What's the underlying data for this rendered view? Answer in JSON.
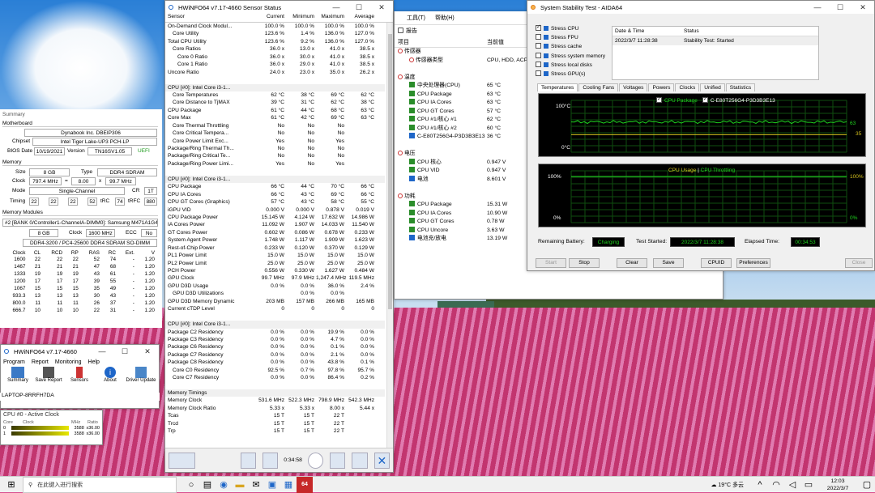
{
  "hwinfo_sensor": {
    "title": "HWiNFO64 v7.17-4660 Sensor Status",
    "headers": [
      "Sensor",
      "Current",
      "Minimum",
      "Maximum",
      "Average"
    ],
    "rows": [
      {
        "k": "i",
        "c": [
          "On-Demand Clock Modul...",
          "100.0 %",
          "100.0 %",
          "100.0 %",
          "100.0 %"
        ]
      },
      {
        "k": "c",
        "c": [
          "Core Utility",
          "123.6 %",
          "1.4 %",
          "136.0 %",
          "127.0 %"
        ]
      },
      {
        "k": "i",
        "c": [
          "Total CPU Utility",
          "123.6 %",
          "9.2 %",
          "136.0 %",
          "127.0 %"
        ]
      },
      {
        "k": "c",
        "c": [
          "Core Ratios",
          "36.0 x",
          "13.0 x",
          "41.0 x",
          "38.5 x"
        ]
      },
      {
        "k": "d",
        "c": [
          "Core 0 Ratio",
          "36.0 x",
          "30.0 x",
          "41.0 x",
          "38.5 x"
        ]
      },
      {
        "k": "d",
        "c": [
          "Core 1 Ratio",
          "36.0 x",
          "29.0 x",
          "41.0 x",
          "38.5 x"
        ]
      },
      {
        "k": "i",
        "c": [
          "Uncore Ratio",
          "24.0 x",
          "23.0 x",
          "35.0 x",
          "26.2 x"
        ]
      },
      {
        "k": "b",
        "c": [
          "",
          "",
          "",
          "",
          ""
        ]
      },
      {
        "k": "s",
        "c": [
          "CPU [#0]: Intel Core i3-1...",
          "",
          "",
          "",
          ""
        ]
      },
      {
        "k": "c",
        "c": [
          "Core Temperatures",
          "62 °C",
          "38 °C",
          "69 °C",
          "62 °C"
        ]
      },
      {
        "k": "c",
        "c": [
          "Core Distance to TjMAX",
          "39 °C",
          "31 °C",
          "62 °C",
          "38 °C"
        ]
      },
      {
        "k": "t",
        "c": [
          "CPU Package",
          "61 °C",
          "44 °C",
          "68 °C",
          "63 °C"
        ]
      },
      {
        "k": "t",
        "c": [
          "Core Max",
          "61 °C",
          "42 °C",
          "69 °C",
          "63 °C"
        ]
      },
      {
        "k": "c",
        "c": [
          "Core Thermal Throttling",
          "No",
          "No",
          "No",
          ""
        ]
      },
      {
        "k": "c",
        "c": [
          "Core Critical Tempera...",
          "No",
          "No",
          "No",
          ""
        ]
      },
      {
        "k": "c",
        "c": [
          "Core Power Limit Exc...",
          "Yes",
          "No",
          "Yes",
          ""
        ]
      },
      {
        "k": "i",
        "c": [
          "Package/Ring Thermal Th...",
          "No",
          "No",
          "No",
          ""
        ]
      },
      {
        "k": "i",
        "c": [
          "Package/Ring Critical Te...",
          "No",
          "No",
          "No",
          ""
        ]
      },
      {
        "k": "i",
        "c": [
          "Package/Ring Power Limi...",
          "Yes",
          "No",
          "Yes",
          ""
        ]
      },
      {
        "k": "b",
        "c": [
          "",
          "",
          "",
          "",
          ""
        ]
      },
      {
        "k": "s",
        "c": [
          "CPU [#0]: Intel Core i3-1...",
          "",
          "",
          "",
          ""
        ]
      },
      {
        "k": "t",
        "c": [
          "CPU Package",
          "66 °C",
          "44 °C",
          "70 °C",
          "66 °C"
        ]
      },
      {
        "k": "t",
        "c": [
          "CPU IA Cores",
          "66 °C",
          "43 °C",
          "69 °C",
          "66 °C"
        ]
      },
      {
        "k": "t",
        "c": [
          "CPU GT Cores (Graphics)",
          "57 °C",
          "43 °C",
          "58 °C",
          "55 °C"
        ]
      },
      {
        "k": "i",
        "c": [
          "iGPU VID",
          "0.000 V",
          "0.000 V",
          "0.878 V",
          "0.019 V"
        ]
      },
      {
        "k": "i",
        "c": [
          "CPU Package Power",
          "15.145 W",
          "4.124 W",
          "17.632 W",
          "14.986 W"
        ]
      },
      {
        "k": "i",
        "c": [
          "IA Cores Power",
          "11.092 W",
          "1.907 W",
          "14.033 W",
          "11.540 W"
        ]
      },
      {
        "k": "i",
        "c": [
          "GT Cores Power",
          "0.602 W",
          "0.086 W",
          "0.678 W",
          "0.233 W"
        ]
      },
      {
        "k": "i",
        "c": [
          "System Agent Power",
          "1.748 W",
          "1.117 W",
          "1.909 W",
          "1.623 W"
        ]
      },
      {
        "k": "i",
        "c": [
          "Rest-of-Chip Power",
          "0.233 W",
          "0.120 W",
          "0.370 W",
          "0.129 W"
        ]
      },
      {
        "k": "i",
        "c": [
          "PL1 Power Limit",
          "15.0 W",
          "15.0 W",
          "15.0 W",
          "15.0 W"
        ]
      },
      {
        "k": "i",
        "c": [
          "PL2 Power Limit",
          "25.0 W",
          "25.0 W",
          "25.0 W",
          "25.0 W"
        ]
      },
      {
        "k": "i",
        "c": [
          "PCH Power",
          "0.556 W",
          "0.330 W",
          "1.627 W",
          "0.484 W"
        ]
      },
      {
        "k": "i",
        "c": [
          "GPU Clock",
          "99.7 MHz",
          "97.9 MHz",
          "1,247.4 MHz",
          "119.5 MHz"
        ]
      },
      {
        "k": "i",
        "c": [
          "GPU D3D Usage",
          "0.0 %",
          "0.0 %",
          "36.0 %",
          "2.4 %"
        ]
      },
      {
        "k": "c",
        "c": [
          "GPU D3D Utilizations",
          "",
          "0.0 %",
          "0.0 %",
          ""
        ]
      },
      {
        "k": "i",
        "c": [
          "GPU D3D Memory Dynamic",
          "203 MB",
          "157 MB",
          "266 MB",
          "165 MB"
        ]
      },
      {
        "k": "i",
        "c": [
          "Current cTDP Level",
          "0",
          "0",
          "0",
          "0"
        ]
      },
      {
        "k": "b",
        "c": [
          "",
          "",
          "",
          "",
          ""
        ]
      },
      {
        "k": "s",
        "c": [
          "CPU [#0]: Intel Core i3-1...",
          "",
          "",
          "",
          ""
        ]
      },
      {
        "k": "i",
        "c": [
          "Package C2 Residency",
          "0.0 %",
          "0.0 %",
          "19.9 %",
          "0.0 %"
        ]
      },
      {
        "k": "i",
        "c": [
          "Package C3 Residency",
          "0.0 %",
          "0.0 %",
          "4.7 %",
          "0.0 %"
        ]
      },
      {
        "k": "i",
        "c": [
          "Package C6 Residency",
          "0.0 %",
          "0.0 %",
          "0.1 %",
          "0.0 %"
        ]
      },
      {
        "k": "i",
        "c": [
          "Package C7 Residency",
          "0.0 %",
          "0.0 %",
          "2.1 %",
          "0.0 %"
        ]
      },
      {
        "k": "i",
        "c": [
          "Package C8 Residency",
          "0.0 %",
          "0.0 %",
          "43.8 %",
          "0.1 %"
        ]
      },
      {
        "k": "c",
        "c": [
          "Core C0 Residency",
          "92.5 %",
          "0.7 %",
          "97.8 %",
          "95.7 %"
        ]
      },
      {
        "k": "c",
        "c": [
          "Core C7 Residency",
          "0.0 %",
          "0.0 %",
          "86.4 %",
          "0.2 %"
        ]
      },
      {
        "k": "b",
        "c": [
          "",
          "",
          "",
          "",
          ""
        ]
      },
      {
        "k": "s",
        "c": [
          "Memory Timings",
          "",
          "",
          "",
          ""
        ]
      },
      {
        "k": "i",
        "c": [
          "Memory Clock",
          "531.6 MHz",
          "522.3 MHz",
          "798.9 MHz",
          "542.3 MHz"
        ]
      },
      {
        "k": "i",
        "c": [
          "Memory Clock Ratio",
          "5.33 x",
          "5.33 x",
          "8.00 x",
          "5.44 x"
        ]
      },
      {
        "k": "i",
        "c": [
          "Tcas",
          "15 T",
          "15 T",
          "22 T",
          ""
        ]
      },
      {
        "k": "i",
        "c": [
          "Trcd",
          "15 T",
          "15 T",
          "22 T",
          ""
        ]
      },
      {
        "k": "i",
        "c": [
          "Trp",
          "15 T",
          "15 T",
          "22 T",
          ""
        ]
      }
    ],
    "timer": "0:34:58"
  },
  "hwinfo_summary": {
    "summary_label": "Summary",
    "motherboard_label": "Motherboard",
    "motherboard": "Dynabook Inc. DBEIP306",
    "chipset_label": "Chipset",
    "chipset": "Intel Tiger Lake-UP3 PCH-LP",
    "bios_label": "BIOS Date",
    "bios_date": "10/19/2021",
    "version_label": "Version",
    "version": "TN16SV1.05",
    "uefi": "UEFI",
    "memory_label": "Memory",
    "size_label": "Size",
    "size": "8 GB",
    "type_label": "Type",
    "type": "DDR4 SDRAM",
    "clock_label": "Clock",
    "clock": "797.4 MHz",
    "eq": "=",
    "mult": "8.00",
    "x": "x",
    "base": "99.7 MHz",
    "mode_label": "Mode",
    "mode": "Single-Channel",
    "cr_label": "CR",
    "cr": "1T",
    "timing_label": "Timing",
    "timings": [
      "22",
      "22",
      "22",
      "52"
    ],
    "trc_label": "tRC",
    "trc": "74",
    "trfc_label": "tRFC",
    "trfc": "880",
    "modules_label": "Memory Modules",
    "module": "#2 [BANK 0/Controller1-ChannelA-DIMM0]: Samsung M471A1G44",
    "m_size": "8 GB",
    "m_clock_label": "Clock",
    "m_clock": "1600 MHz",
    "ecc_label": "ECC",
    "ecc": "No",
    "m_type": "DDR4-3200 / PC4-25600 DDR4 SDRAM SO-DIMM",
    "table_headers": [
      "Clock",
      "CL",
      "RCD",
      "RP",
      "RAS",
      "RC",
      "Ext.",
      "V"
    ],
    "table_rows": [
      [
        "1600",
        "22",
        "22",
        "22",
        "52",
        "74",
        "-",
        "1.20"
      ],
      [
        "1467",
        "21",
        "21",
        "21",
        "47",
        "68",
        "-",
        "1.20"
      ],
      [
        "1333",
        "19",
        "19",
        "19",
        "43",
        "61",
        "-",
        "1.20"
      ],
      [
        "1200",
        "17",
        "17",
        "17",
        "39",
        "55",
        "-",
        "1.20"
      ],
      [
        "1067",
        "15",
        "15",
        "15",
        "35",
        "49",
        "-",
        "1.20"
      ],
      [
        "933.3",
        "13",
        "13",
        "13",
        "30",
        "43",
        "-",
        "1.20"
      ],
      [
        "800.0",
        "11",
        "11",
        "11",
        "26",
        "37",
        "-",
        "1.20"
      ],
      [
        "666.7",
        "10",
        "10",
        "10",
        "22",
        "31",
        "-",
        "1.20"
      ]
    ]
  },
  "hwinfo_main": {
    "title": "HWiNFO64 v7.17-4660",
    "menu": [
      "Program",
      "Report",
      "Monitoring",
      "Help"
    ],
    "tools": [
      "Summary",
      "Save Report",
      "Sensors",
      "About",
      "Driver Update"
    ],
    "host": "LAPTOP-8RRFH7DA"
  },
  "active_clock": {
    "title": "CPU #0 - Active Clock",
    "headers": [
      "Core",
      "Clock",
      "MHz",
      "Ratio"
    ],
    "rows": [
      [
        "0",
        "3588",
        "x36.00"
      ],
      [
        "1",
        "3588",
        "x36.00"
      ]
    ]
  },
  "aida_menu": {
    "tools": "工具(T)",
    "help": "帮助(H)",
    "report": "报告"
  },
  "aida_tree": {
    "headers": [
      "项目",
      "当前值"
    ],
    "items": [
      {
        "icon": "sensor",
        "label": "传感器",
        "value": "",
        "lvl": 0
      },
      {
        "icon": "sensor",
        "label": "传感器类型",
        "value": "CPU, HDD, ACP",
        "lvl": 1
      },
      {
        "icon": "",
        "label": "",
        "value": "",
        "lvl": 0
      },
      {
        "icon": "temp",
        "label": "温度",
        "value": "",
        "lvl": 0
      },
      {
        "icon": "g",
        "label": "中央处理器(CPU)",
        "value": "65 °C",
        "lvl": 1
      },
      {
        "icon": "g",
        "label": "CPU Package",
        "value": "63 °C",
        "lvl": 1
      },
      {
        "icon": "g",
        "label": "CPU IA Cores",
        "value": "63 °C",
        "lvl": 1
      },
      {
        "icon": "g",
        "label": "CPU GT Cores",
        "value": "57 °C",
        "lvl": 1
      },
      {
        "icon": "g",
        "label": "CPU #1/核心 #1",
        "value": "62 °C",
        "lvl": 1
      },
      {
        "icon": "g",
        "label": "CPU #1/核心 #2",
        "value": "60 °C",
        "lvl": 1
      },
      {
        "icon": "b",
        "label": "C-E80T256G4-P3D3B3E13",
        "value": "36 °C",
        "lvl": 1
      },
      {
        "icon": "",
        "label": "",
        "value": "",
        "lvl": 0
      },
      {
        "icon": "volt",
        "label": "电压",
        "value": "",
        "lvl": 0
      },
      {
        "icon": "g",
        "label": "CPU 核心",
        "value": "0.947 V",
        "lvl": 1
      },
      {
        "icon": "g",
        "label": "CPU VID",
        "value": "0.947 V",
        "lvl": 1
      },
      {
        "icon": "b",
        "label": "电池",
        "value": "8.601 V",
        "lvl": 1
      },
      {
        "icon": "",
        "label": "",
        "value": "",
        "lvl": 0
      },
      {
        "icon": "power",
        "label": "功耗",
        "value": "",
        "lvl": 0
      },
      {
        "icon": "g",
        "label": "CPU Package",
        "value": "15.31 W",
        "lvl": 1
      },
      {
        "icon": "g",
        "label": "CPU IA Cores",
        "value": "10.90 W",
        "lvl": 1
      },
      {
        "icon": "g",
        "label": "CPU GT Cores",
        "value": "0.78 W",
        "lvl": 1
      },
      {
        "icon": "g",
        "label": "CPU Uncore",
        "value": "3.63 W",
        "lvl": 1
      },
      {
        "icon": "b",
        "label": "电池充/放电",
        "value": "13.19 W",
        "lvl": 1
      }
    ]
  },
  "stability": {
    "title": "System Stability Test - AIDA64",
    "stress": [
      {
        "label": "Stress CPU",
        "on": true
      },
      {
        "label": "Stress FPU",
        "on": false
      },
      {
        "label": "Stress cache",
        "on": false
      },
      {
        "label": "Stress system memory",
        "on": false
      },
      {
        "label": "Stress local disks",
        "on": false
      },
      {
        "label": "Stress GPU(s)",
        "on": false
      }
    ],
    "log_headers": [
      "Date & Time",
      "Status"
    ],
    "log_row": [
      "2022/3/7 11:28:38",
      "Stability Test: Started"
    ],
    "tabs": [
      "Temperatures",
      "Cooling Fans",
      "Voltages",
      "Powers",
      "Clocks",
      "Unified",
      "Statistics"
    ],
    "legend": [
      "CPU Package",
      "C-E80T256G4-P3D3B3E13"
    ],
    "temp_axis": [
      "100°C",
      "0°C"
    ],
    "temp_values": [
      "63",
      "35"
    ],
    "usage_legend": "CPU Usage",
    "throttle_legend": "CPU Throttling",
    "usage_axis": [
      "100%",
      "0%"
    ],
    "usage_right": [
      "100%",
      "0%"
    ],
    "battery_label": "Remaining Battery:",
    "battery": "Charging",
    "started_label": "Test Started:",
    "started": "2022/3/7 11:28:38",
    "elapsed_label": "Elapsed Time:",
    "elapsed": "00:34:53",
    "buttons": [
      "Start",
      "Stop",
      "Clear",
      "Save",
      "CPUID",
      "Preferences",
      "Close"
    ]
  },
  "taskbar": {
    "search": "在此键入进行搜索",
    "weather": "19°C 多云",
    "time": "12:03",
    "date": "2022/3/7",
    "app64": "64"
  }
}
